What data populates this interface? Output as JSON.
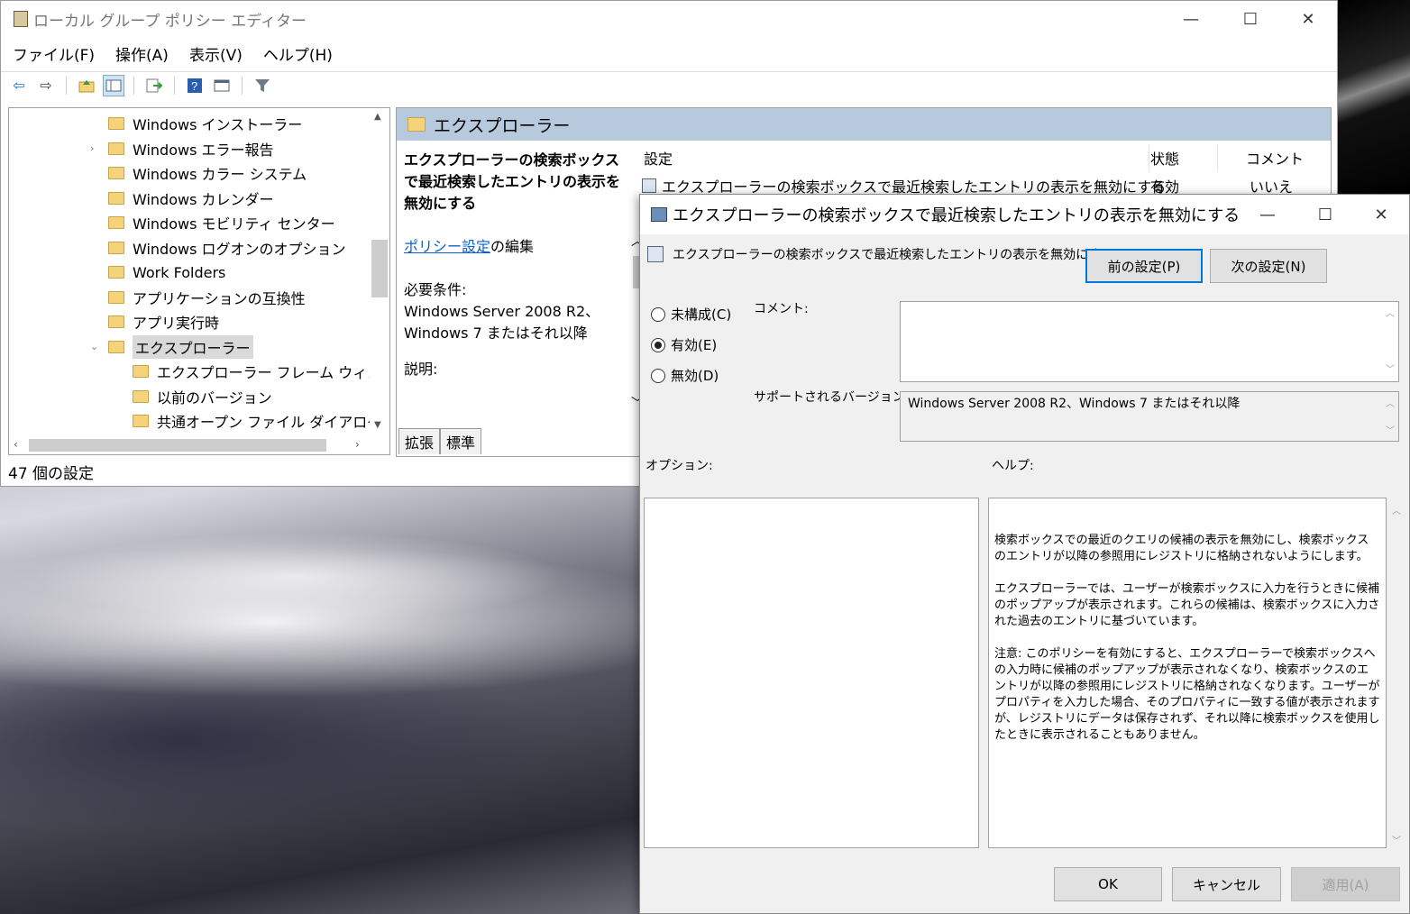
{
  "main_window": {
    "title": "ローカル グループ ポリシー エディター",
    "controls": {
      "minimize": "—",
      "maximize": "☐",
      "close": "✕"
    },
    "menu": [
      "ファイル(F)",
      "操作(A)",
      "表示(V)",
      "ヘルプ(H)"
    ],
    "toolbar_icons": [
      "back-arrow-icon",
      "forward-arrow-icon",
      "up-folder-icon",
      "show-hide-tree-icon",
      "export-list-icon",
      "help-icon",
      "properties-icon",
      "filter-icon"
    ],
    "tree": [
      {
        "label": "Windows インストーラー",
        "level": 1,
        "expander": ""
      },
      {
        "label": "Windows エラー報告",
        "level": 1,
        "expander": "›"
      },
      {
        "label": "Windows カラー システム",
        "level": 1,
        "expander": ""
      },
      {
        "label": "Windows カレンダー",
        "level": 1,
        "expander": ""
      },
      {
        "label": "Windows モビリティ センター",
        "level": 1,
        "expander": ""
      },
      {
        "label": "Windows ログオンのオプション",
        "level": 1,
        "expander": ""
      },
      {
        "label": "Work Folders",
        "level": 1,
        "expander": ""
      },
      {
        "label": "アプリケーションの互換性",
        "level": 1,
        "expander": ""
      },
      {
        "label": "アプリ実行時",
        "level": 1,
        "expander": ""
      },
      {
        "label": "エクスプローラー",
        "level": 1,
        "expander": "⌄",
        "selected": true
      },
      {
        "label": "エクスプローラー フレーム ウィンドウ",
        "level": 2,
        "expander": ""
      },
      {
        "label": "以前のバージョン",
        "level": 2,
        "expander": ""
      },
      {
        "label": "共通オープン ファイル ダイアログ",
        "level": 2,
        "expander": ""
      }
    ],
    "status": "47 個の設定",
    "right_pane": {
      "header": "エクスプローラー",
      "desc_title": "エクスプローラーの検索ボックスで最近検索したエントリの表示を無効にする",
      "desc_link": "ポリシー設定",
      "desc_link_suffix": "の編集",
      "requirements_label": "必要条件:",
      "requirements_value": "Windows Server 2008 R2、Windows 7 またはそれ以降",
      "description_label": "説明:",
      "columns": {
        "setting": "設定",
        "state": "状態",
        "comment": "コメント"
      },
      "row": {
        "setting": "エクスプローラーの検索ボックスで最近検索したエントリの表示を無効にする",
        "state": "有効",
        "comment": "いいえ"
      },
      "tabs": [
        "拡張",
        "標準"
      ]
    }
  },
  "dialog": {
    "title": "エクスプローラーの検索ボックスで最近検索したエントリの表示を無効にする",
    "controls": {
      "minimize": "—",
      "maximize": "☐",
      "close": "✕"
    },
    "policy_name": "エクスプローラーの検索ボックスで最近検索したエントリの表示を無効にする",
    "prev_button": "前の設定(P)",
    "next_button": "次の設定(N)",
    "radios": [
      {
        "label": "未構成(C)",
        "checked": false
      },
      {
        "label": "有効(E)",
        "checked": true
      },
      {
        "label": "無効(D)",
        "checked": false
      }
    ],
    "comment_label": "コメント:",
    "supported_label": "サポートされるバージョン:",
    "supported_value": "Windows Server 2008 R2、Windows 7 またはそれ以降",
    "options_label": "オプション:",
    "help_label": "ヘルプ:",
    "help_paragraphs": [
      "検索ボックスでの最近のクエリの候補の表示を無効にし、検索ボックスのエントリが以降の参照用にレジストリに格納されないようにします。",
      "エクスプローラーでは、ユーザーが検索ボックスに入力を行うときに候補のポップアップが表示されます。これらの候補は、検索ボックスに入力された過去のエントリに基づいています。",
      "注意: このポリシーを有効にすると、エクスプローラーで検索ボックスへの入力時に候補のポップアップが表示されなくなり、検索ボックスのエントリが以降の参照用にレジストリに格納されなくなります。ユーザーがプロパティを入力した場合、そのプロパティに一致する値が表示されますが、レジストリにデータは保存されず、それ以降に検索ボックスを使用したときに表示されることもありません。"
    ],
    "ok_button": "OK",
    "cancel_button": "キャンセル",
    "apply_button": "適用(A)"
  }
}
